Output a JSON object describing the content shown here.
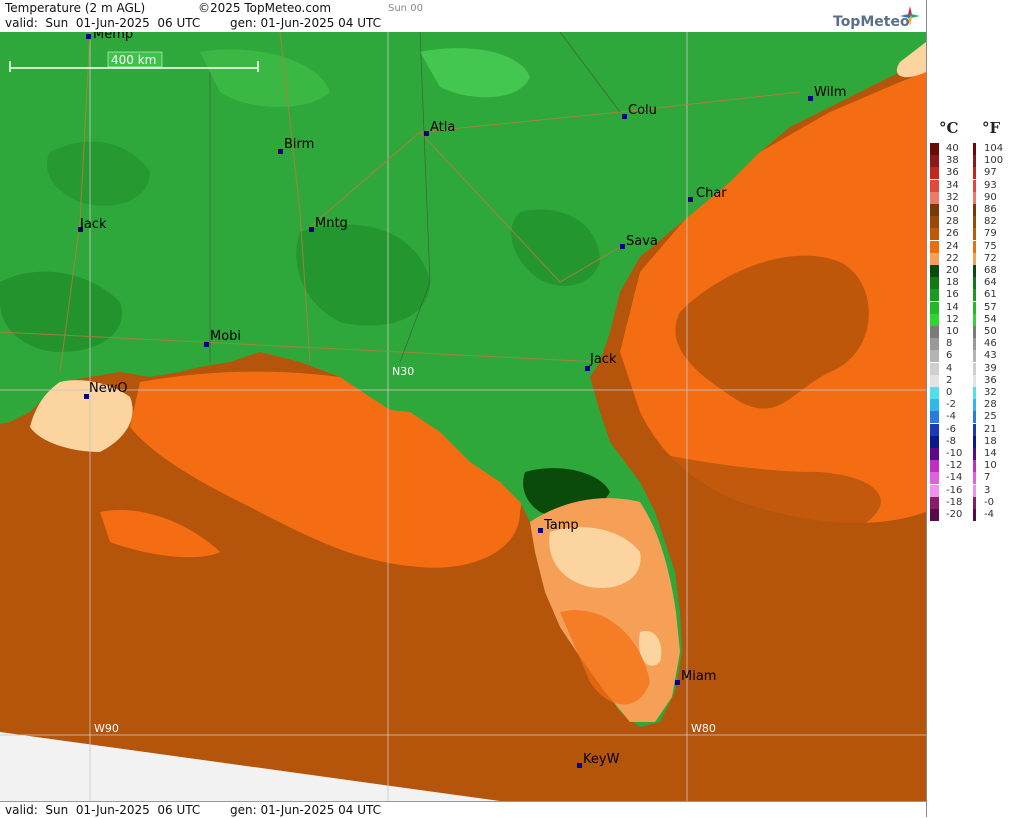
{
  "header": {
    "title": "Temperature (2 m AGL)",
    "copyright": "©2025 TopMeteo.com",
    "run": "Sun 00",
    "valid_line": "valid:  Sun  01-Jun-2025  06 UTC",
    "gen_line": "gen: 01-Jun-2025 04 UTC",
    "logo": "TopMeteo"
  },
  "footer": {
    "valid_line": "valid:  Sun  01-Jun-2025  06 UTC",
    "gen_line": "gen: 01-Jun-2025 04 UTC"
  },
  "map": {
    "scale_label": "400 km",
    "grid_labels": {
      "lat30": "N30",
      "lon90": "W90",
      "lon80": "W80"
    },
    "cities": [
      {
        "name": "Memp"
      },
      {
        "name": "Birm"
      },
      {
        "name": "Atla"
      },
      {
        "name": "Colu"
      },
      {
        "name": "Wilm"
      },
      {
        "name": "Jack"
      },
      {
        "name": "Mntg"
      },
      {
        "name": "Char"
      },
      {
        "name": "Sava"
      },
      {
        "name": "Mobi"
      },
      {
        "name": "Jack"
      },
      {
        "name": "NewO"
      },
      {
        "name": "Tamp"
      },
      {
        "name": "Miam"
      },
      {
        "name": "KeyW"
      }
    ],
    "colors": {
      "land_green": "#2ea83a",
      "ocean_orange": "#f46d12",
      "ocean_brown": "#b5540b",
      "coast_light": "#fbd4a0"
    }
  },
  "legend": {
    "celsius_label": "°C",
    "fahrenheit_label": "°F",
    "celsius": [
      "40",
      "38",
      "36",
      "34",
      "32",
      "30",
      "28",
      "26",
      "24",
      "22",
      "20",
      "18",
      "16",
      "14",
      "12",
      "10",
      "8",
      "6",
      "4",
      "2",
      "0",
      "-2",
      "-4",
      "-6",
      "-8",
      "-10",
      "-12",
      "-14",
      "-16",
      "-18",
      "-20"
    ],
    "fahrenheit": [
      "104",
      "100",
      "97",
      "93",
      "90",
      "86",
      "82",
      "79",
      "75",
      "72",
      "68",
      "64",
      "61",
      "57",
      "54",
      "50",
      "46",
      "43",
      "39",
      "36",
      "32",
      "28",
      "25",
      "21",
      "18",
      "14",
      "10",
      "7",
      "3",
      "-0",
      "-4"
    ],
    "colors": [
      "#6a0a0a",
      "#8c1a1a",
      "#c0281e",
      "#e04a3c",
      "#f07a6a",
      "#7a3a05",
      "#9a4a08",
      "#c05a0a",
      "#e86e0e",
      "#f5a056",
      "#0a4a0a",
      "#127a14",
      "#1a9a1e",
      "#24b82a",
      "#30d436",
      "#7a7a7a",
      "#999999",
      "#b4b4b4",
      "#cfcfcf",
      "#e4e4e4",
      "#4fe0f0",
      "#2fb8e8",
      "#2a7ae0",
      "#1a3ab8",
      "#0a1a8a",
      "#5a0a8a",
      "#c030c0",
      "#e060e0",
      "#f090f0",
      "#8a1a6a",
      "#5a0a4a"
    ]
  }
}
